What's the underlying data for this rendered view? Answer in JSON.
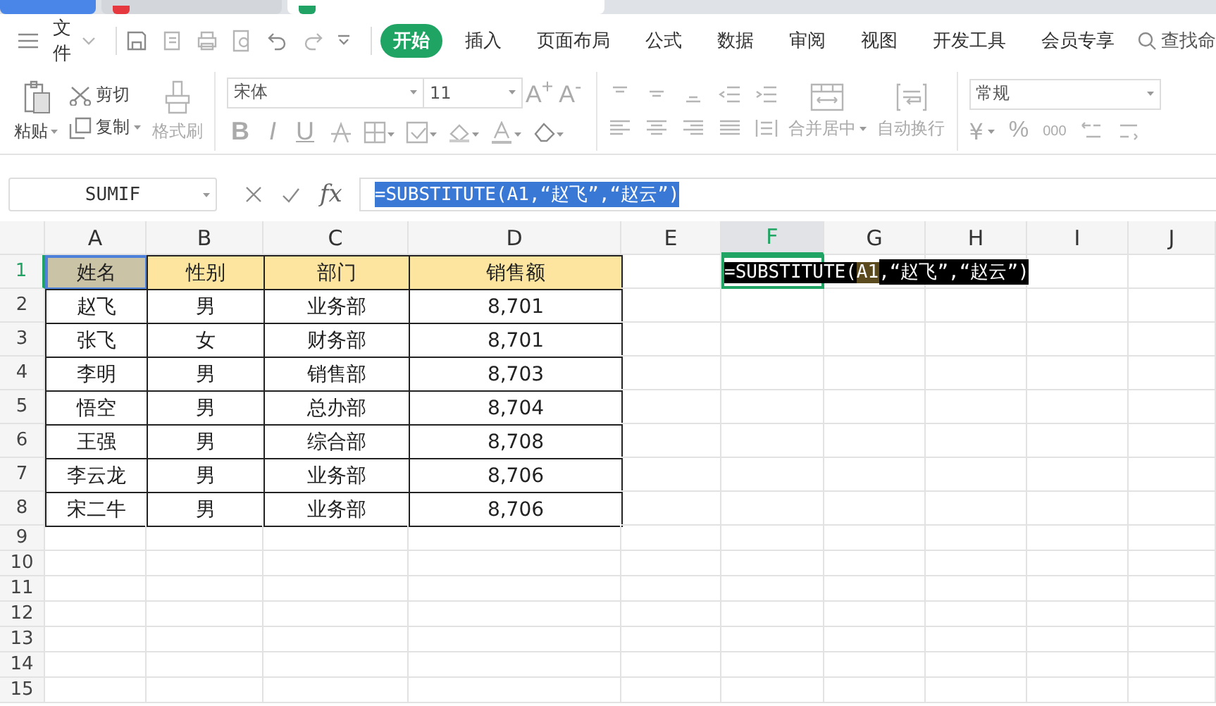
{
  "document_tabs": [
    {
      "kind": "home",
      "selected": false
    },
    {
      "kind": "document",
      "selected": false,
      "color": "#e5393f"
    },
    {
      "kind": "document",
      "selected": true,
      "color": "#21a366"
    }
  ],
  "menu": {
    "file": "文件",
    "ribbon_tabs": [
      {
        "label": "开始",
        "selected": true
      },
      {
        "label": "插入",
        "selected": false
      },
      {
        "label": "页面布局",
        "selected": false
      },
      {
        "label": "公式",
        "selected": false
      },
      {
        "label": "数据",
        "selected": false
      },
      {
        "label": "审阅",
        "selected": false
      },
      {
        "label": "视图",
        "selected": false
      },
      {
        "label": "开发工具",
        "selected": false
      },
      {
        "label": "会员专享",
        "selected": false
      }
    ],
    "search": "查找命"
  },
  "ribbon": {
    "paste": "粘贴",
    "cut": "剪切",
    "copy": "复制",
    "format_painter": "格式刷",
    "font_name": "宋体",
    "font_size": "11",
    "font_size_buttons": [
      "A$^{+}$",
      "A$^{-}$"
    ],
    "style_buttons": [
      "B",
      "I",
      "U"
    ],
    "merge": "合并居中",
    "wrap": "自动换行",
    "number_format": "常规",
    "currency": "¥",
    "percent": "%",
    "thousands": "000"
  },
  "formula_bar": {
    "name_box": "SUMIF",
    "function_label": "fx",
    "formula": "=SUBSTITUTE(A1,“赵飞”,“赵云”)"
  },
  "sheet": {
    "columns": [
      {
        "label": "A",
        "selected": false
      },
      {
        "label": "B",
        "selected": false
      },
      {
        "label": "C",
        "selected": false
      },
      {
        "label": "D",
        "selected": false
      },
      {
        "label": "E",
        "selected": false
      },
      {
        "label": "F",
        "selected": true
      },
      {
        "label": "G",
        "selected": false
      },
      {
        "label": "H",
        "selected": false
      },
      {
        "label": "I",
        "selected": false
      },
      {
        "label": "J",
        "selected": false
      }
    ],
    "rows": [
      {
        "label": "1",
        "selected": true,
        "kind": "header",
        "cells": [
          {
            "text": "姓名",
            "referenced": true
          },
          {
            "text": "性别",
            "referenced": false
          },
          {
            "text": "部门",
            "referenced": false
          },
          {
            "text": "销售额",
            "referenced": false
          }
        ]
      },
      {
        "label": "2",
        "selected": false,
        "kind": "data",
        "cells": [
          "赵飞",
          "男",
          "业务部",
          "8,701"
        ]
      },
      {
        "label": "3",
        "selected": false,
        "kind": "data",
        "cells": [
          "张飞",
          "女",
          "财务部",
          "8,701"
        ]
      },
      {
        "label": "4",
        "selected": false,
        "kind": "data",
        "cells": [
          "李明",
          "男",
          "销售部",
          "8,703"
        ]
      },
      {
        "label": "5",
        "selected": false,
        "kind": "data",
        "cells": [
          "悟空",
          "男",
          "总办部",
          "8,704"
        ]
      },
      {
        "label": "6",
        "selected": false,
        "kind": "data",
        "cells": [
          "王强",
          "男",
          "综合部",
          "8,708"
        ]
      },
      {
        "label": "7",
        "selected": false,
        "kind": "data",
        "cells": [
          "李云龙",
          "男",
          "业务部",
          "8,706"
        ]
      },
      {
        "label": "8",
        "selected": false,
        "kind": "data",
        "cells": [
          "宋二牛",
          "男",
          "业务部",
          "8,706"
        ]
      },
      {
        "label": "9",
        "selected": false,
        "kind": "empty"
      },
      {
        "label": "10",
        "selected": false,
        "kind": "empty"
      },
      {
        "label": "11",
        "selected": false,
        "kind": "empty"
      },
      {
        "label": "12",
        "selected": false,
        "kind": "empty"
      },
      {
        "label": "13",
        "selected": false,
        "kind": "empty"
      },
      {
        "label": "14",
        "selected": false,
        "kind": "empty"
      },
      {
        "label": "15",
        "selected": false,
        "kind": "empty"
      }
    ],
    "editing_text": [
      {
        "text": "=SUBSTITUTE(",
        "reference": false
      },
      {
        "text": "A1",
        "reference": true
      },
      {
        "text": ",“赵飞”,“赵云”)",
        "reference": false
      }
    ]
  }
}
